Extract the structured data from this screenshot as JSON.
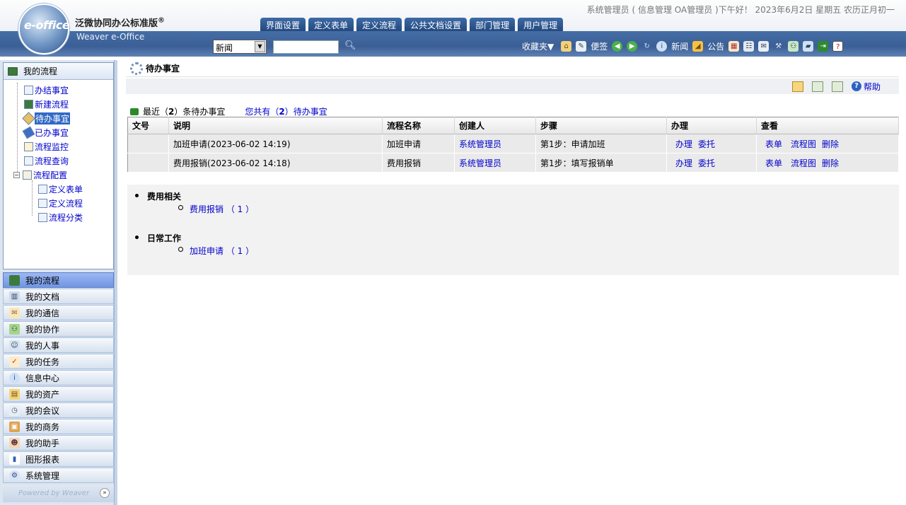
{
  "header": {
    "logo_text": "e-office",
    "product_cn": "泛微协同办公标准版",
    "product_reg": "®",
    "product_en": "Weaver e-Office",
    "greeting": "系统管理员 ( 信息管理 OA管理员 )下午好！ 2023年6月2日 星期五 农历正月初一",
    "tabs": [
      "界面设置",
      "定义表单",
      "定义流程",
      "公共文档设置",
      "部门管理",
      "用户管理"
    ],
    "search_select": "新闻",
    "search_placeholder": "",
    "favorites": "收藏夹▼",
    "tools": {
      "note": "便签",
      "news": "新闻",
      "notice": "公告"
    }
  },
  "left": {
    "tree_title": "我的流程",
    "tree_items": [
      "办结事宜",
      "新建流程",
      "待办事宜",
      "已办事宜",
      "流程监控",
      "流程查询",
      "流程配置"
    ],
    "tree_sub": [
      "定义表单",
      "定义流程",
      "流程分类"
    ],
    "collapse_sign": "−",
    "menu": [
      "我的流程",
      "我的文档",
      "我的通信",
      "我的协作",
      "我的人事",
      "我的任务",
      "信息中心",
      "我的资产",
      "我的会议",
      "我的商务",
      "我的助手",
      "图形报表",
      "系统管理"
    ],
    "powered": "Powered by Weaver",
    "expand": "»"
  },
  "main": {
    "title": "待办事宜",
    "help": "帮助",
    "summary_prefix": "最近（",
    "summary_count": "2",
    "summary_suffix": "）条待办事宜",
    "total_prefix": "您共有（",
    "total_count": "2",
    "total_suffix": "）待办事宜",
    "columns": [
      "文号",
      "说明",
      "流程名称",
      "创建人",
      "步骤",
      "办理",
      "查看"
    ],
    "rows": [
      {
        "no": "",
        "desc": "加班申请(2023-06-02 14:19)",
        "flow": "加班申请",
        "creator": "系统管理员",
        "step": "第1步：申请加班",
        "do1": "办理",
        "do2": "委托",
        "v1": "表单",
        "v2": "流程图",
        "v3": "删除"
      },
      {
        "no": "",
        "desc": "费用报销(2023-06-02 14:18)",
        "flow": "费用报销",
        "creator": "系统管理员",
        "step": "第1步：填写报销单",
        "do1": "办理",
        "do2": "委托",
        "v1": "表单",
        "v2": "流程图",
        "v3": "删除"
      }
    ],
    "groups": [
      {
        "name": "费用相关",
        "item": "费用报销 （ 1 ）"
      },
      {
        "name": "日常工作",
        "item": "加班申请 （ 1 ）"
      }
    ]
  },
  "colors": {
    "accent_blue": "#3b5f96",
    "link": "#0000cc",
    "selected": "#3169c6"
  }
}
